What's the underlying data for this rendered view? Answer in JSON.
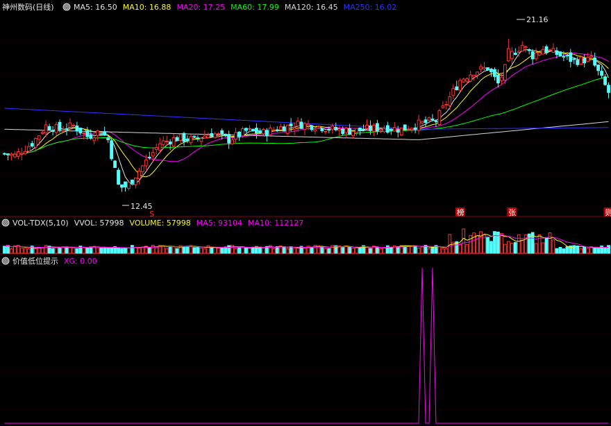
{
  "colors": {
    "background": "#000000",
    "grid": "#3a0000",
    "panel_divider": "#8a0000",
    "up": "#ff3232",
    "down": "#54ffff",
    "white": "#e6e6e6",
    "ma5": "#e6e6e6",
    "ma10": "#ffff00",
    "ma20": "#ff00ff",
    "ma60": "#00ff00",
    "ma120": "#d8d8d8",
    "ma250": "#3232ff",
    "xg": "#ff00ff"
  },
  "main_panel": {
    "title": "神州数码(日线)",
    "circle_icon": "circle-icon",
    "indicators": [
      {
        "label": "MA5: 16.50",
        "color": "#e6e6e6"
      },
      {
        "label": "MA10: 16.88",
        "color": "#ffff00"
      },
      {
        "label": "MA20: 17.25",
        "color": "#ff00ff"
      },
      {
        "label": "MA60: 17.99",
        "color": "#00ff00"
      },
      {
        "label": "MA120: 16.45",
        "color": "#d8d8d8"
      },
      {
        "label": "MA250: 16.02",
        "color": "#3232ff"
      }
    ],
    "high_label": "21.16",
    "low_label": "12.45",
    "markers": [
      {
        "text": "S",
        "type": "sell-marker",
        "index": 43
      },
      {
        "text": "榜",
        "type": "list-badge",
        "index": 132
      },
      {
        "text": "张",
        "type": "limit-badge",
        "index": 147
      },
      {
        "text": "则",
        "type": "rule-badge",
        "index": 175
      }
    ]
  },
  "volume_panel": {
    "circle_icon": "circle-icon",
    "indicators": [
      {
        "label": "VOL-TDX(5,10)",
        "color": "#e6e6e6"
      },
      {
        "label": "VVOL: 57998",
        "color": "#e6e6e6"
      },
      {
        "label": "VOLUME: 57998",
        "color": "#ffff00"
      },
      {
        "label": "MA5: 93104",
        "color": "#ff00ff"
      },
      {
        "label": "MA10: 112127",
        "color": "#ff00ff"
      }
    ]
  },
  "xg_panel": {
    "circle_icon": "circle-icon",
    "indicators": [
      {
        "label": "价值低位提示",
        "color": "#e6e6e6"
      },
      {
        "label": "XG: 0.00",
        "color": "#ff00ff"
      }
    ]
  },
  "chart_data": {
    "type": "candlestick",
    "count": 176,
    "price_range": [
      11.5,
      22.5
    ],
    "ohlc_keypoints": [
      [
        0,
        14.6
      ],
      [
        3,
        14.5
      ],
      [
        8,
        15.2
      ],
      [
        12,
        16.2
      ],
      [
        16,
        16.0
      ],
      [
        20,
        16.2
      ],
      [
        24,
        15.6
      ],
      [
        28,
        15.9
      ],
      [
        30,
        15.4
      ],
      [
        33,
        12.8
      ],
      [
        35,
        12.6
      ],
      [
        40,
        13.9
      ],
      [
        45,
        15.2
      ],
      [
        50,
        15.5
      ],
      [
        55,
        15.4
      ],
      [
        60,
        15.8
      ],
      [
        65,
        15.4
      ],
      [
        70,
        15.9
      ],
      [
        75,
        15.8
      ],
      [
        80,
        16.1
      ],
      [
        85,
        16.3
      ],
      [
        90,
        16.2
      ],
      [
        95,
        16.0
      ],
      [
        100,
        15.9
      ],
      [
        105,
        16.0
      ],
      [
        110,
        16.1
      ],
      [
        115,
        16.0
      ],
      [
        120,
        16.3
      ],
      [
        125,
        16.5
      ],
      [
        128,
        17.5
      ],
      [
        132,
        18.8
      ],
      [
        136,
        19.3
      ],
      [
        140,
        19.5
      ],
      [
        143,
        18.6
      ],
      [
        147,
        20.3
      ],
      [
        150,
        20.8
      ],
      [
        153,
        20.2
      ],
      [
        156,
        20.6
      ],
      [
        160,
        20.3
      ],
      [
        165,
        19.9
      ],
      [
        170,
        20.0
      ],
      [
        175,
        18.1
      ]
    ],
    "xg_signals": [
      121,
      124
    ]
  }
}
